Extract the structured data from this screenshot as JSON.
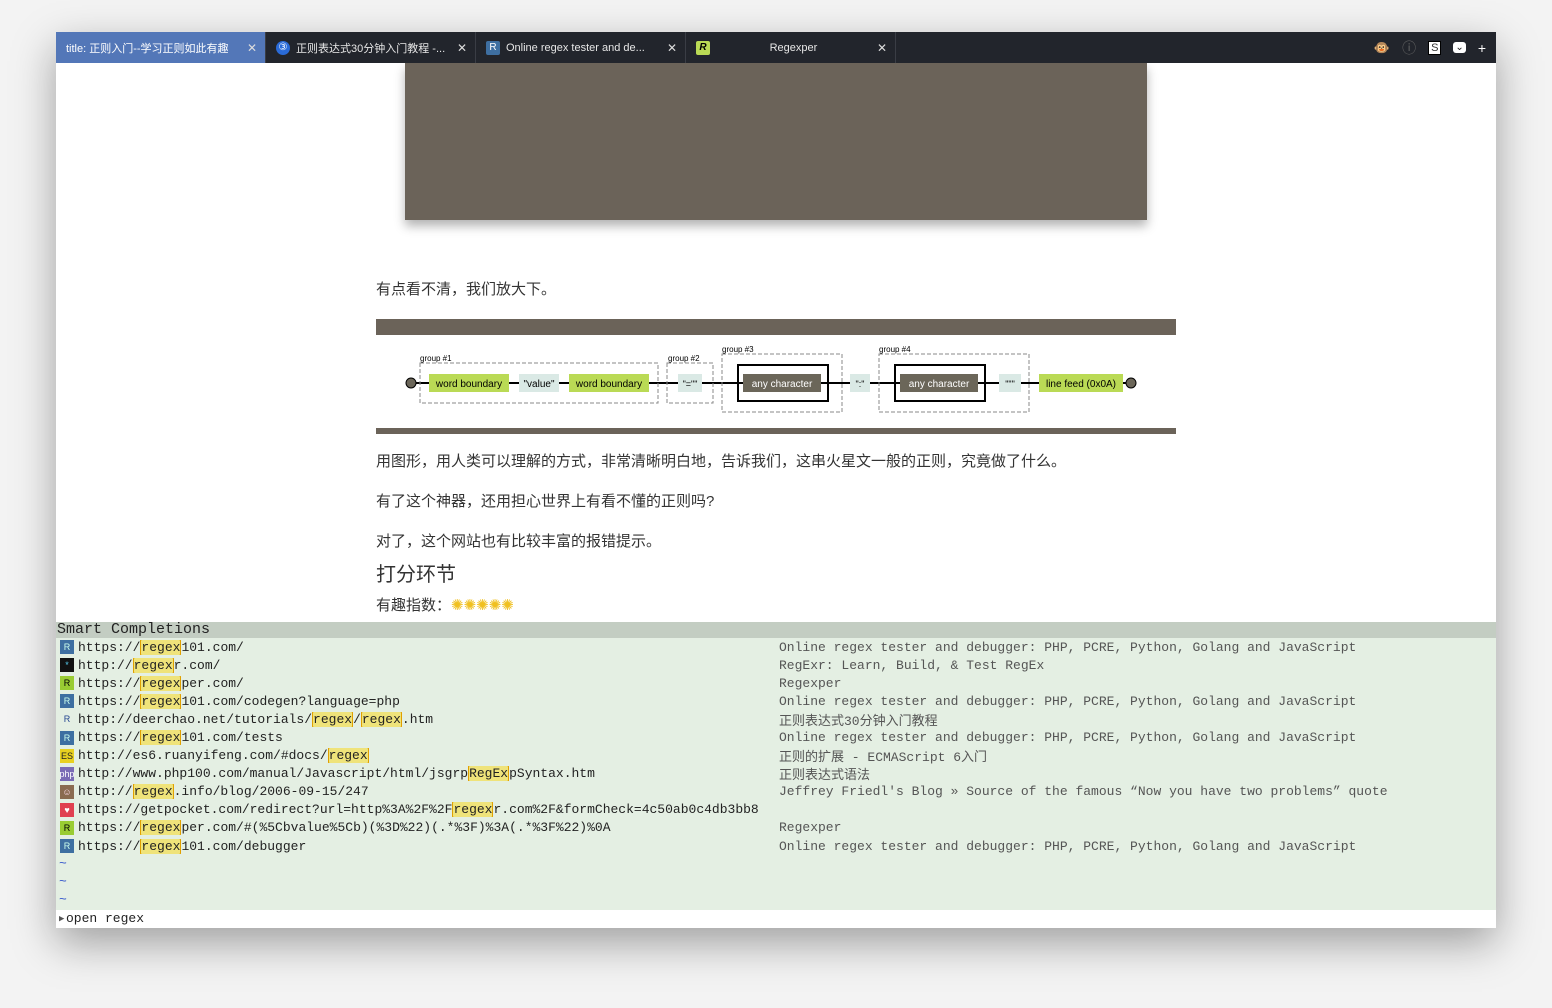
{
  "tabs": [
    {
      "label": "title: 正则入门--学习正则如此有趣",
      "active": true,
      "icon": "none"
    },
    {
      "label": "正则表达式30分钟入门教程 -...",
      "icon": "deerchao-icon"
    },
    {
      "label": "Online regex tester and de...",
      "icon": "regex101-icon"
    },
    {
      "label": "Regexper",
      "icon": "regexper-icon"
    }
  ],
  "toolbar_icons": [
    "monkey-icon",
    "info-icon",
    "s-icon",
    "pocket-icon",
    "new-tab-icon"
  ],
  "article": {
    "p1": "有点看不清，我们放大下。",
    "p2": "用图形，用人类可以理解的方式，非常清晰明白地，告诉我们，这串火星文一般的正则，究竟做了什么。",
    "p3": "有了这个神器，还用担心世界上有看不懂的正则吗?",
    "p4": "对了，这个网站也有比较丰富的报错提示。",
    "h3": "打分环节",
    "p5": "有趣指数："
  },
  "diagram": {
    "groups": [
      "group #1",
      "group #2",
      "group #3",
      "group #4"
    ],
    "nodes": [
      "word boundary",
      "\"value\"",
      "word boundary",
      "\"=\"\"",
      "any character",
      "\":\"",
      "any character",
      "\"\"\"",
      "line feed (0x0A)"
    ]
  },
  "completions": {
    "header": "Smart Completions",
    "rows": [
      {
        "pre": "https://",
        "hl": "regex",
        "post": "101.com/",
        "title": "Online regex tester and debugger: PHP, PCRE, Python, Golang and JavaScript",
        "icon": "regex101-icon"
      },
      {
        "pre": "http://",
        "hl": "regex",
        "post": "r.com/",
        "title": "RegExr: Learn, Build, & Test RegEx",
        "icon": "regexr-icon"
      },
      {
        "pre": "https://",
        "hl": "regex",
        "post": "per.com/",
        "title": "Regexper",
        "icon": "regexper-icon"
      },
      {
        "pre": "https://",
        "hl": "regex",
        "post": "101.com/codegen?language=php",
        "title": "Online regex tester and debugger: PHP, PCRE, Python, Golang and JavaScript",
        "icon": "regex101-icon"
      },
      {
        "pre": "http://deerchao.net/tutorials/",
        "hl": "regex",
        "mid": "/",
        "hl2": "regex",
        "post": ".htm",
        "title": "正则表达式30分钟入门教程",
        "icon": "deerchao-icon"
      },
      {
        "pre": "https://",
        "hl": "regex",
        "post": "101.com/tests",
        "title": "Online regex tester and debugger: PHP, PCRE, Python, Golang and JavaScript",
        "icon": "regex101-icon"
      },
      {
        "pre": "http://es6.ruanyifeng.com/#docs/",
        "hl": "regex",
        "post": "",
        "title": "正则的扩展 - ECMAScript 6入门",
        "icon": "es6-icon"
      },
      {
        "pre": "http://www.php100.com/manual/Javascript/html/jsgrp",
        "hl": "RegEx",
        "post": "pSyntax.htm",
        "title": "正则表达式语法",
        "icon": "php-icon"
      },
      {
        "pre": "http://",
        "hl": "regex",
        "post": ".info/blog/2006-09-15/247",
        "title": "Jeffrey Friedl's Blog » Source of the famous “Now you have two problems” quote",
        "icon": "avatar-icon"
      },
      {
        "pre": "https://getpocket.com/redirect?url=http%3A%2F%2F",
        "hl": "regex",
        "post": "r.com%2F&formCheck=4c50ab0c4db3bb8",
        "title": "",
        "icon": "pocket-icon"
      },
      {
        "pre": "https://",
        "hl": "regex",
        "post": "per.com/#(%5Cbvalue%5Cb)(%3D%22)(.*%3F)%3A(.*%3F%22)%0A",
        "title": "Regexper",
        "icon": "regexper-icon"
      },
      {
        "pre": "https://",
        "hl": "regex",
        "post": "101.com/debugger",
        "title": "Online regex tester and debugger: PHP, PCRE, Python, Golang and JavaScript",
        "icon": "regex101-icon"
      }
    ],
    "tilde": "~"
  },
  "command": "open regex",
  "colors": {
    "tab_active": "#5377b8",
    "tabbar": "#22252c",
    "highlight": "#efe37a",
    "panel_bg": "#e4efe3",
    "panel_header": "#c3cdc2",
    "diagram_green": "#bada55",
    "diagram_dark": "#6b6659"
  }
}
